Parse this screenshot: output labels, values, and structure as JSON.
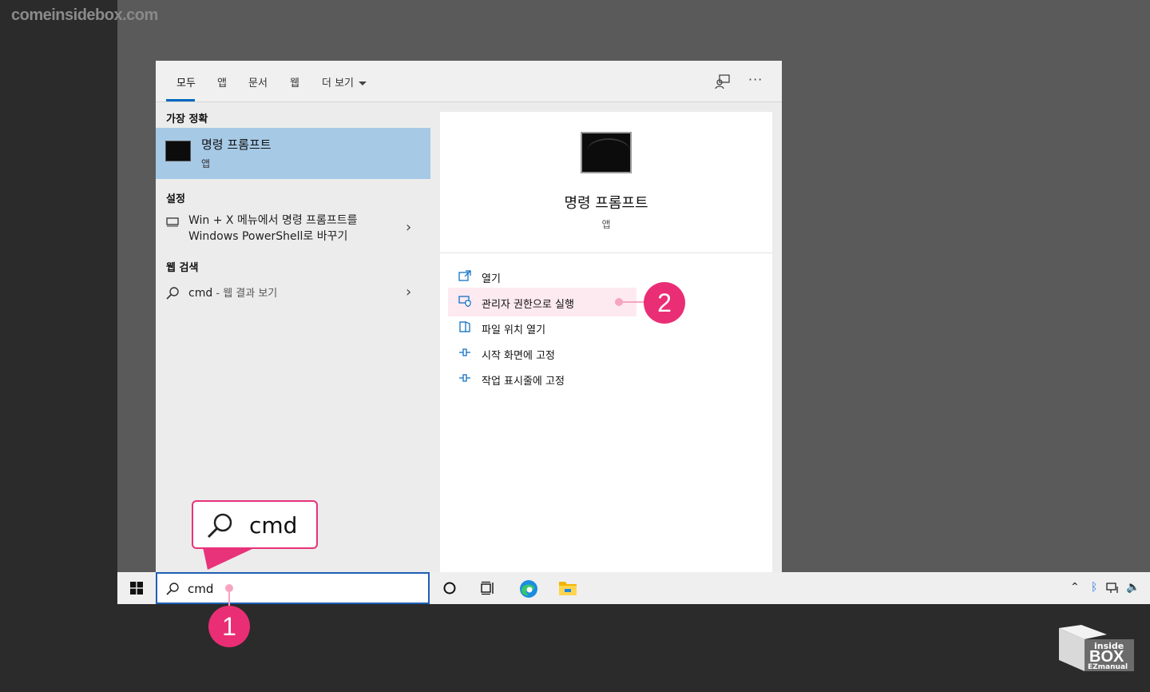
{
  "watermark": "comeinsidebox.com",
  "tabs": [
    {
      "label": "모두"
    },
    {
      "label": "앱"
    },
    {
      "label": "문서"
    },
    {
      "label": "웹"
    },
    {
      "label": "더 보기"
    }
  ],
  "left": {
    "best_match_header": "가장 정확",
    "best_match": {
      "title": "명령 프롬프트",
      "subtitle": "앱"
    },
    "settings_header": "설정",
    "settings_item": {
      "line1": "Win + X 메뉴에서 명령 프롬프트를",
      "line2": "Windows PowerShell로 바꾸기"
    },
    "web_header": "웹 검색",
    "web_item": {
      "query": "cmd",
      "suffix": " - 웹 결과 보기"
    }
  },
  "right": {
    "title": "명령 프롬프트",
    "subtitle": "앱",
    "actions": [
      {
        "label": "열기",
        "icon": "open-icon"
      },
      {
        "label": "관리자 권한으로 실행",
        "icon": "shield-icon"
      },
      {
        "label": "파일 위치 열기",
        "icon": "folder-icon"
      },
      {
        "label": "시작 화면에 고정",
        "icon": "pin-icon"
      },
      {
        "label": "작업 표시줄에 고정",
        "icon": "pin-icon"
      }
    ]
  },
  "taskbar": {
    "search_value": "cmd"
  },
  "callout": {
    "text": "cmd"
  },
  "badges": {
    "one": "1",
    "two": "2"
  },
  "logo": {
    "line1": "inside",
    "line2": "BOX",
    "line3": "EZmanual"
  },
  "colors": {
    "accent": "#0067c0",
    "highlight": "#a6c9e6",
    "callout": "#e8327a"
  }
}
